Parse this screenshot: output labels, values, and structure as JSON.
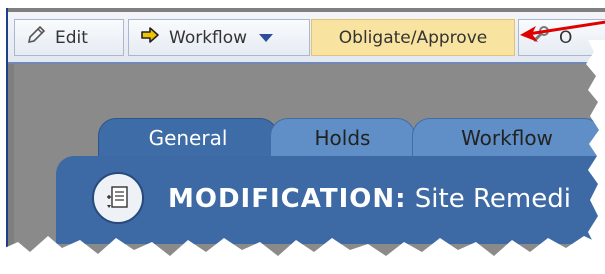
{
  "toolbar": {
    "edit_label": "Edit",
    "workflow_label": "Workflow",
    "obligate_label": "Obligate/Approve",
    "more_label": "O"
  },
  "tabs": [
    {
      "label": "General"
    },
    {
      "label": "Holds"
    },
    {
      "label": "Workflow"
    }
  ],
  "header": {
    "label": "MODIFICATION:",
    "value": "Site Remedi"
  },
  "colors": {
    "accent": "#3d6aa5",
    "highlight": "#f9e3a0",
    "annotation": "#e00000"
  },
  "icons": {
    "edit": "pencil-icon",
    "workflow": "arrow-right-icon",
    "dropdown": "chevron-down-icon",
    "more": "wrench-icon",
    "document": "document-icon"
  }
}
